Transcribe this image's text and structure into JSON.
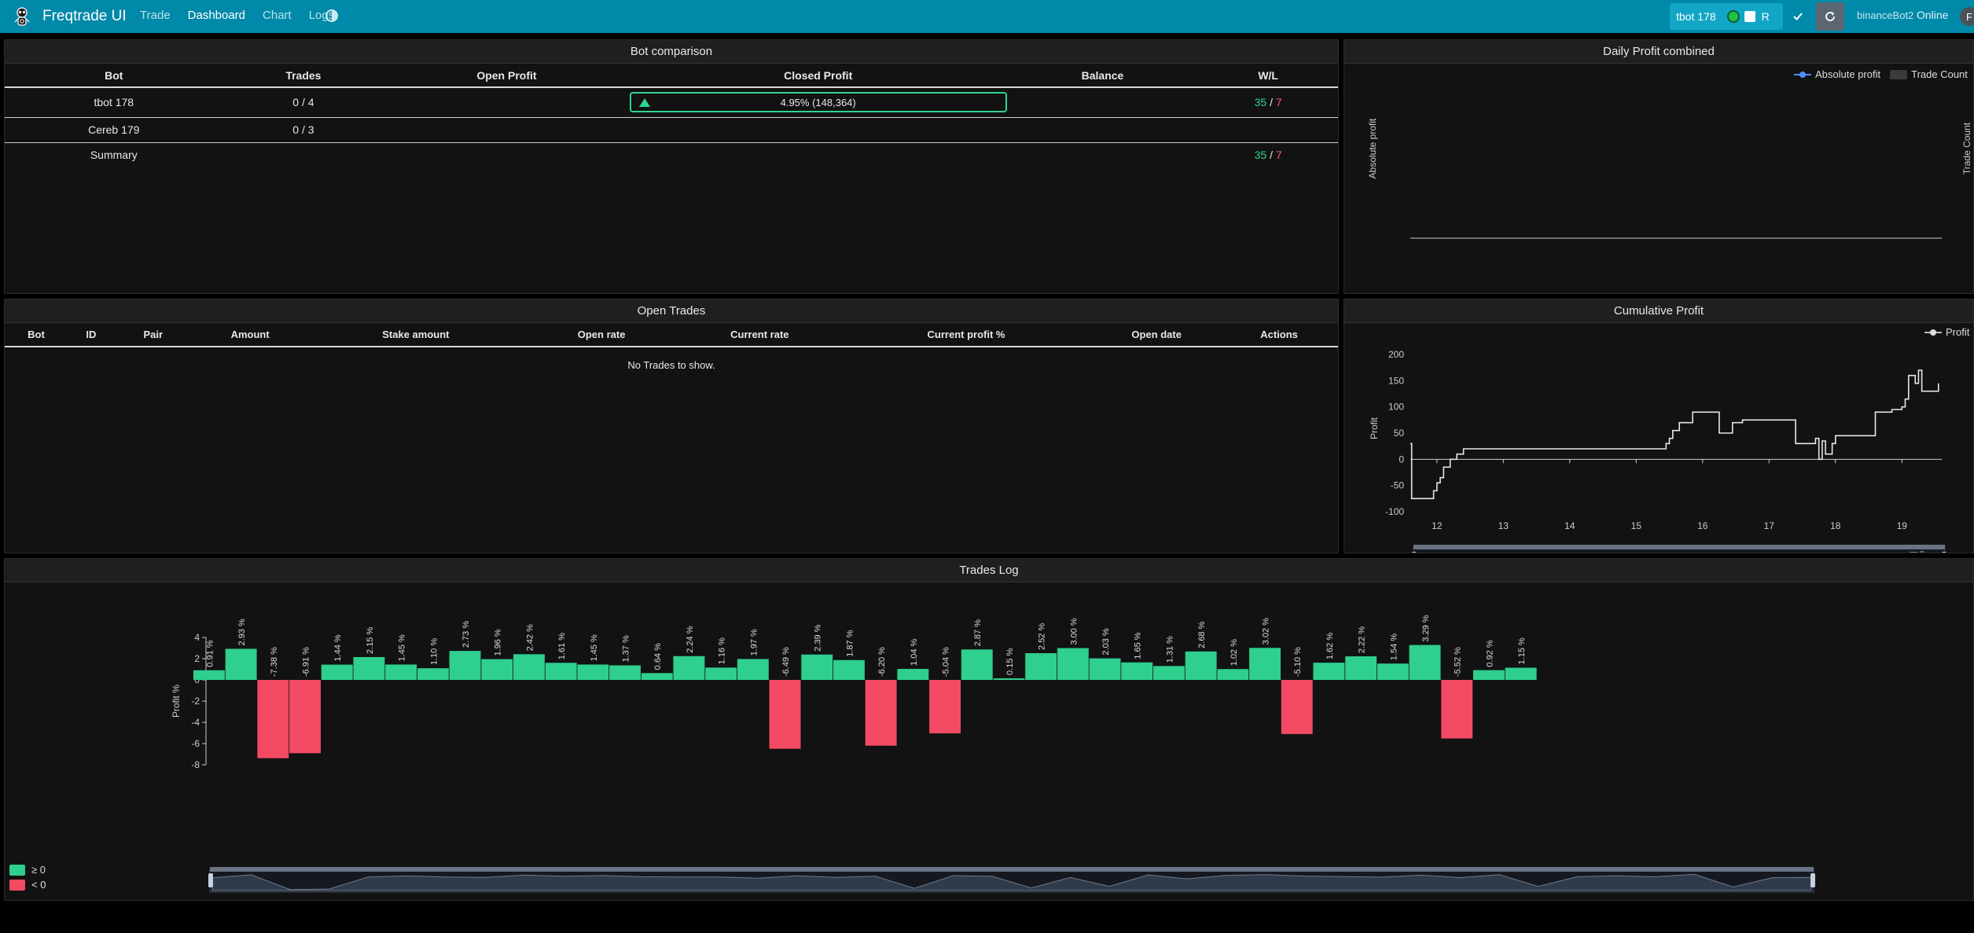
{
  "navbar": {
    "brand": "Freqtrade UI",
    "links": [
      "Trade",
      "Dashboard",
      "Chart",
      "Logs"
    ],
    "active_link": "Dashboard",
    "bot_select": {
      "label": "tbot 178",
      "r_label": "R"
    },
    "bot_name": "binanceBot2",
    "status": "Online",
    "avatar": "F"
  },
  "bot_comparison": {
    "title": "Bot comparison",
    "columns": [
      "Bot",
      "Trades",
      "Open Profit",
      "Closed Profit",
      "Balance",
      "W/L"
    ],
    "rows": [
      {
        "bot": "tbot 178",
        "trades": "0 / 4",
        "open_profit": "",
        "closed_profit": "4.95% (148,364)",
        "balance": "",
        "wins": "35",
        "losses": "7"
      },
      {
        "bot": "Cereb 179",
        "trades": "0 / 3",
        "open_profit": "",
        "closed_profit": "",
        "balance": "",
        "wins": "",
        "losses": ""
      }
    ],
    "summary": {
      "label": "Summary",
      "wins": "35",
      "losses": "7"
    },
    "wl_separator": "/"
  },
  "daily_profit": {
    "title": "Daily Profit combined",
    "legend": [
      "Absolute profit",
      "Trade Count"
    ],
    "y_left_label": "Absolute profit",
    "y_right_label": "Trade Count"
  },
  "open_trades": {
    "title": "Open Trades",
    "columns": [
      "Bot",
      "ID",
      "Pair",
      "Amount",
      "Stake amount",
      "Open rate",
      "Current rate",
      "Current profit %",
      "Open date",
      "Actions"
    ],
    "empty_text": "No Trades to show."
  },
  "cumulative_profit": {
    "title": "Cumulative Profit",
    "legend": "Profit",
    "y_label": "Profit"
  },
  "trades_log": {
    "title": "Trades Log",
    "legend_pos": "≥ 0",
    "legend_neg": "< 0",
    "colors": {
      "positive": "#2ecf8f",
      "negative": "#f24a63"
    }
  },
  "chart_data": [
    {
      "type": "line",
      "title": "Cumulative Profit",
      "ylabel": "Profit",
      "ylim": [
        -100,
        200
      ],
      "yticks": [
        -100,
        -50,
        0,
        50,
        100,
        150,
        200
      ],
      "xticks": [
        "12",
        "13",
        "14",
        "15",
        "16",
        "17",
        "18",
        "19"
      ],
      "xlim": [
        11.6,
        19.6
      ],
      "series": [
        {
          "name": "Profit",
          "x": [
            11.6,
            11.62,
            11.62,
            11.95,
            11.95,
            12.0,
            12.0,
            12.05,
            12.05,
            12.1,
            12.1,
            12.2,
            12.2,
            12.3,
            12.3,
            12.4,
            12.4,
            15.45,
            15.45,
            15.5,
            15.5,
            15.55,
            15.55,
            15.65,
            15.65,
            15.85,
            15.85,
            16.25,
            16.25,
            16.45,
            16.45,
            16.6,
            16.6,
            17.4,
            17.4,
            17.7,
            17.7,
            17.75,
            17.75,
            17.8,
            17.8,
            17.85,
            17.85,
            17.95,
            17.95,
            18.0,
            18.0,
            18.6,
            18.6,
            18.85,
            18.85,
            19.0,
            19.0,
            19.05,
            19.05,
            19.1,
            19.1,
            19.2,
            19.2,
            19.25,
            19.25,
            19.3,
            19.3,
            19.55,
            19.55
          ],
          "y": [
            30,
            30,
            -75,
            -75,
            -60,
            -60,
            -45,
            -45,
            -35,
            -35,
            -15,
            -15,
            0,
            0,
            10,
            10,
            20,
            20,
            30,
            30,
            40,
            40,
            55,
            55,
            70,
            70,
            90,
            90,
            50,
            50,
            70,
            70,
            75,
            75,
            30,
            30,
            40,
            40,
            0,
            0,
            35,
            35,
            10,
            10,
            30,
            30,
            45,
            45,
            90,
            90,
            95,
            95,
            100,
            100,
            115,
            115,
            160,
            160,
            145,
            145,
            170,
            170,
            130,
            130,
            145
          ]
        }
      ]
    },
    {
      "type": "bar",
      "title": "Trades Log",
      "ylabel": "Profit %",
      "ylim": [
        -8,
        4
      ],
      "yticks": [
        -8,
        -6,
        -4,
        -2,
        0,
        2,
        4
      ],
      "data_labels": [
        "0.91 %",
        "2.93 %",
        "-7.38 %",
        "-6.91 %",
        "1.44 %",
        "2.15 %",
        "1.45 %",
        "1.10 %",
        "2.73 %",
        "1.96 %",
        "2.42 %",
        "1.61 %",
        "1.45 %",
        "1.37 %",
        "0.64 %",
        "2.24 %",
        "1.16 %",
        "1.97 %",
        "-6.49 %",
        "2.39 %",
        "1.87 %",
        "-6.20 %",
        "1.04 %",
        "-5.04 %",
        "2.87 %",
        "0.15 %",
        "2.52 %",
        "3.00 %",
        "2.03 %",
        "1.65 %",
        "1.31 %",
        "2.68 %",
        "1.02 %",
        "3.02 %",
        "-5.10 %",
        "1.62 %",
        "2.22 %",
        "1.54 %",
        "3.29 %",
        "-5.52 %",
        "0.92 %",
        "1.15 %"
      ],
      "values": [
        0.91,
        2.93,
        -7.38,
        -6.91,
        1.44,
        2.15,
        1.45,
        1.1,
        2.73,
        1.96,
        2.42,
        1.61,
        1.45,
        1.37,
        0.64,
        2.24,
        1.16,
        1.97,
        -6.49,
        2.39,
        1.87,
        -6.2,
        1.04,
        -5.04,
        2.87,
        0.15,
        2.52,
        3.0,
        2.03,
        1.65,
        1.31,
        2.68,
        1.02,
        3.02,
        -5.1,
        1.62,
        2.22,
        1.54,
        3.29,
        -5.52,
        0.92,
        1.15
      ],
      "legend": [
        "≥ 0",
        "< 0"
      ]
    }
  ]
}
